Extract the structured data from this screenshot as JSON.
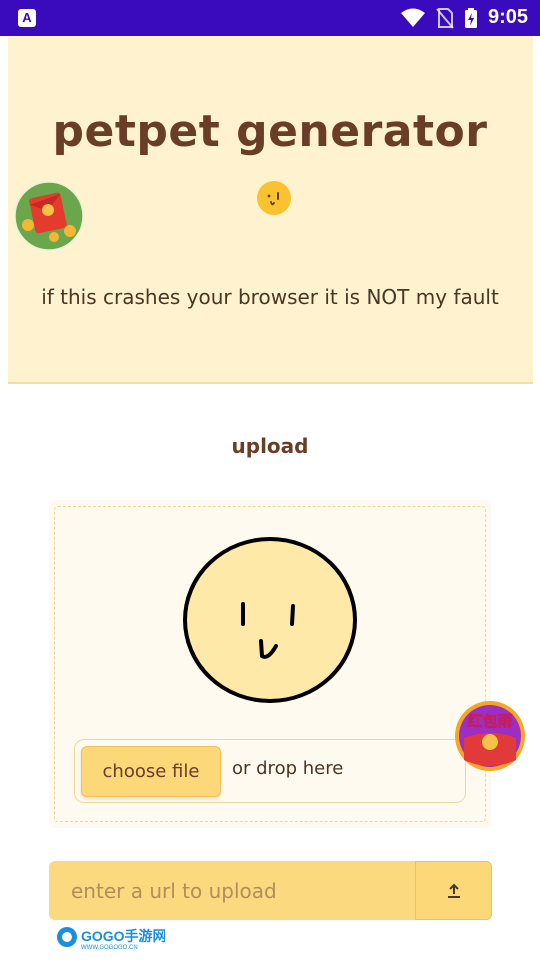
{
  "status_bar": {
    "time": "9:05",
    "left_icon_letter": "A",
    "icons": [
      "app-notification-icon",
      "wifi-icon",
      "no-sim-icon",
      "battery-charging-icon"
    ]
  },
  "header": {
    "title": "petpet generator",
    "subtitle": "if this crashes your browser it is NOT my fault"
  },
  "upload": {
    "heading": "upload",
    "choose_file_label": "choose file",
    "drop_hint": "or drop here"
  },
  "url_upload": {
    "placeholder": "enter a url to upload",
    "button_icon": "upload-arrow-icon"
  },
  "overlays": {
    "badge_text": "红包雨",
    "watermark_text": "GOGO手游网",
    "watermark_url": "WWW.GOGOGO.CN"
  },
  "colors": {
    "status_bar_bg": "#3a0bbd",
    "header_bg": "#fff3cf",
    "title": "#6a3d26",
    "accent": "#fcd878"
  }
}
